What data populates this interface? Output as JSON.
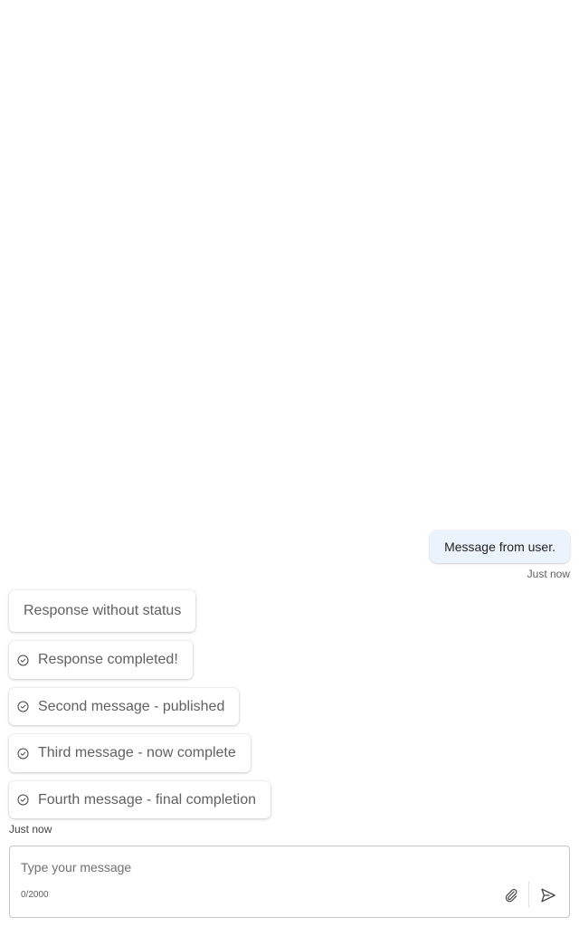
{
  "conversation": {
    "user_message": {
      "text": "Message from user.",
      "timestamp": "Just now"
    },
    "bot_messages": [
      {
        "text": "Response without status",
        "status": null
      },
      {
        "text": "Response completed!",
        "status": "check-circle-icon"
      },
      {
        "text": "Second message - published",
        "status": "check-circle-icon"
      },
      {
        "text": "Third message - now complete",
        "status": "check-circle-icon"
      },
      {
        "text": "Fourth message - final completion",
        "status": "check-circle-icon"
      }
    ],
    "bot_timestamp": "Just now"
  },
  "composer": {
    "placeholder": "Type your message",
    "value": "",
    "char_count": "0/2000",
    "attach_icon": "paperclip-icon",
    "send_icon": "send-icon"
  },
  "colors": {
    "user_bubble": "#ebf3fc",
    "bot_bubble": "#ffffff",
    "border": "#c8c8c8"
  }
}
